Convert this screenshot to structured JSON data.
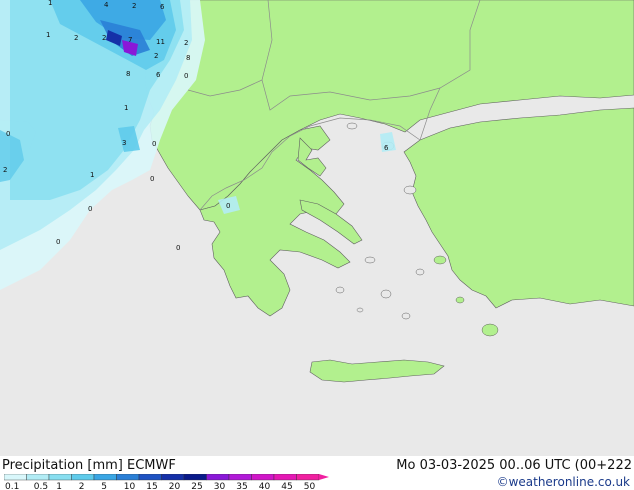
{
  "map": {
    "precip_values": [
      "1",
      "4",
      "2",
      "6",
      "1",
      "2",
      "2",
      "7",
      "11",
      "2",
      "8",
      "6",
      "0",
      "2",
      "8",
      "1",
      "0",
      "3",
      "0",
      "2",
      "1",
      "0",
      "0",
      "0",
      "0",
      "6",
      "0"
    ]
  },
  "footer": {
    "title": "Precipitation [mm] ECMWF",
    "timestamp": "Mo 03-03-2025 00..06 UTC (00+222",
    "credit": "©weatheronline.co.uk"
  },
  "legend": {
    "ticks": [
      "0.1",
      "0.5",
      "1",
      "2",
      "5",
      "10",
      "15",
      "20",
      "25",
      "30",
      "35",
      "40",
      "45",
      "50"
    ],
    "colors": [
      "#d9f7fb",
      "#b2ecf5",
      "#88def0",
      "#5fcbeb",
      "#3aa6e4",
      "#2a7fd6",
      "#1e52c2",
      "#1530a8",
      "#0a1a8a",
      "#8a18d8",
      "#b11ad8",
      "#d016c8",
      "#e418b4",
      "#f020a0"
    ]
  },
  "colors": {
    "land": "#b2f08e",
    "sea": "#e9e9e9",
    "border": "#8c8c8c",
    "coast": "#606060"
  }
}
